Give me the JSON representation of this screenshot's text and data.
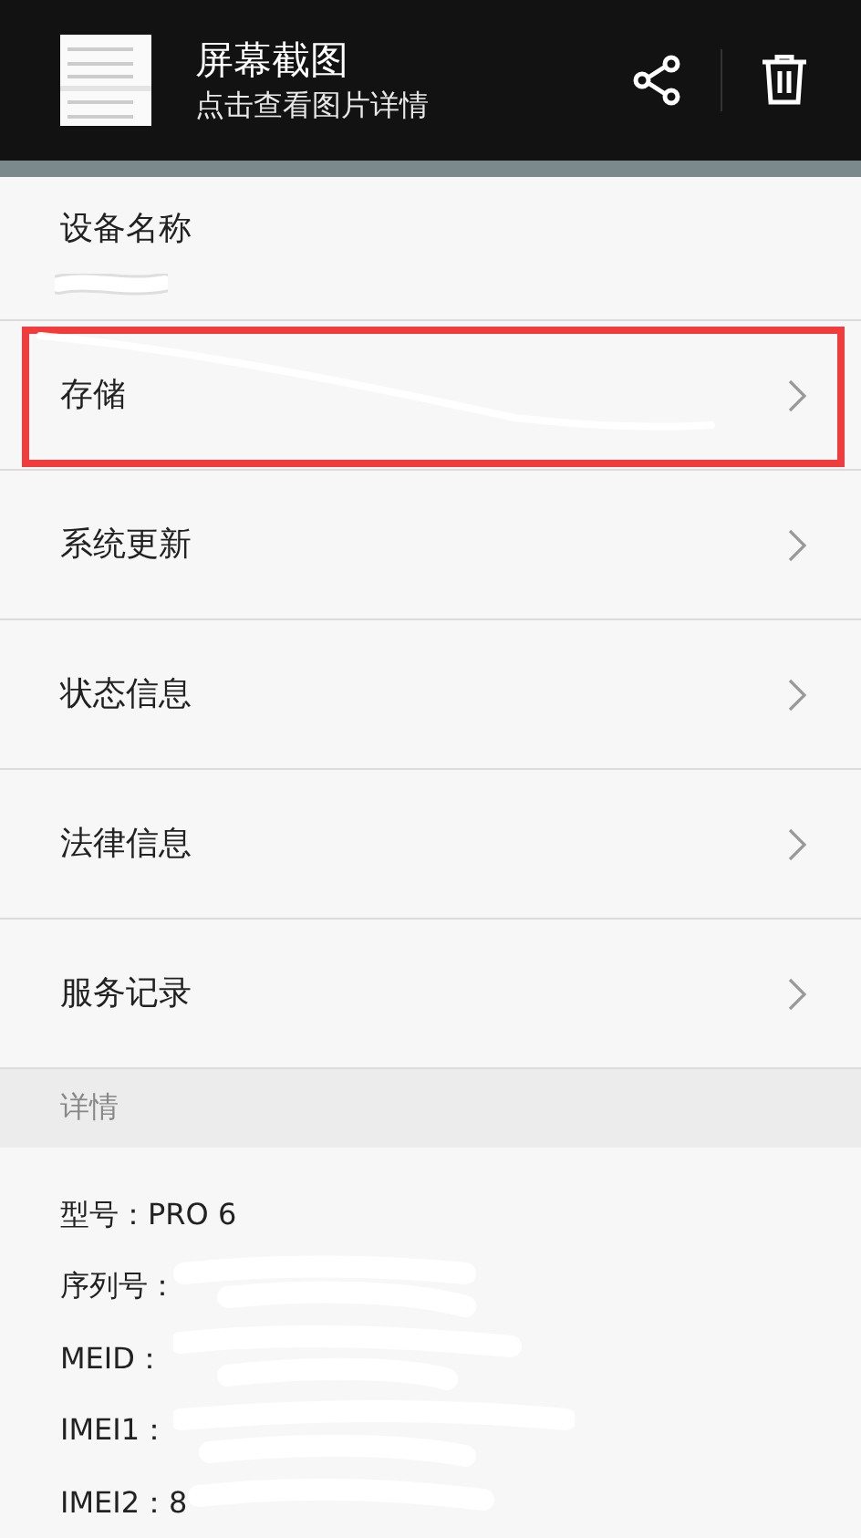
{
  "notification": {
    "title": "屏幕截图",
    "subtitle": "点击查看图片详情"
  },
  "device_name": {
    "label": "设备名称"
  },
  "menu_items": [
    {
      "label": "存储",
      "highlighted": true
    },
    {
      "label": "系统更新",
      "highlighted": false
    },
    {
      "label": "状态信息",
      "highlighted": false
    },
    {
      "label": "法律信息",
      "highlighted": false
    },
    {
      "label": "服务记录",
      "highlighted": false
    }
  ],
  "section_header": "详情",
  "details": [
    "型号：PRO 6",
    "序列号：",
    "MEID：",
    "IMEI1：",
    "IMEI2：8"
  ]
}
